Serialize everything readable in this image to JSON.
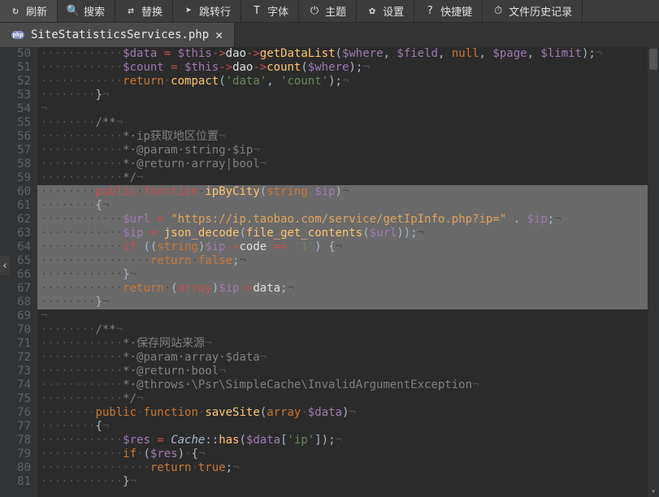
{
  "toolbar": {
    "items": [
      {
        "icon": "↻",
        "label": "刷新"
      },
      {
        "icon": "🔍",
        "label": "搜索"
      },
      {
        "icon": "⇄",
        "label": "替换"
      },
      {
        "icon": "➤",
        "label": "跳转行"
      },
      {
        "icon": "T",
        "label": "字体"
      },
      {
        "icon": "⏻",
        "label": "主题"
      },
      {
        "icon": "✿",
        "label": "设置"
      },
      {
        "icon": "?",
        "label": "快捷键"
      },
      {
        "icon": "⏱",
        "label": "文件历史记录"
      }
    ]
  },
  "tab": {
    "filename": "SiteStatisticsServices.php",
    "icon": "php"
  },
  "editor": {
    "first_line": 50,
    "selected": [
      60,
      61,
      62,
      63,
      64,
      65,
      66,
      67,
      68
    ],
    "lines": [
      [
        [
          "ws",
          "···"
        ],
        [
          "var",
          "$data"
        ],
        [
          "op",
          " "
        ],
        [
          "kw2",
          "="
        ],
        [
          "op",
          " "
        ],
        [
          "var",
          "$this"
        ],
        [
          "kw2",
          "->"
        ],
        [
          "nm",
          "dao"
        ],
        [
          "kw2",
          "->"
        ],
        [
          "fn",
          "getDataList"
        ],
        [
          "op",
          "("
        ],
        [
          "var",
          "$where"
        ],
        [
          "op",
          ", "
        ],
        [
          "var",
          "$field"
        ],
        [
          "op",
          ", "
        ],
        [
          "kw",
          "null"
        ],
        [
          "op",
          ", "
        ],
        [
          "var",
          "$page"
        ],
        [
          "op",
          ", "
        ],
        [
          "var",
          "$limit"
        ],
        [
          "op",
          ");"
        ],
        [
          "ws",
          "¬"
        ]
      ],
      [
        [
          "ws",
          "···"
        ],
        [
          "var",
          "$count"
        ],
        [
          "op",
          " "
        ],
        [
          "kw2",
          "="
        ],
        [
          "op",
          " "
        ],
        [
          "var",
          "$this"
        ],
        [
          "kw2",
          "->"
        ],
        [
          "nm",
          "dao"
        ],
        [
          "kw2",
          "->"
        ],
        [
          "fn",
          "count"
        ],
        [
          "op",
          "("
        ],
        [
          "var",
          "$where"
        ],
        [
          "op",
          ");"
        ],
        [
          "ws",
          "¬"
        ]
      ],
      [
        [
          "ws",
          "···"
        ],
        [
          "kw",
          "return"
        ],
        [
          "ws",
          "·"
        ],
        [
          "fn",
          "compact"
        ],
        [
          "op",
          "("
        ],
        [
          "str",
          "'data'"
        ],
        [
          "op",
          ", "
        ],
        [
          "str",
          "'count'"
        ],
        [
          "op",
          ");"
        ],
        [
          "ws",
          "¬"
        ]
      ],
      [
        [
          "ws",
          "··"
        ],
        [
          "op",
          "}"
        ],
        [
          "ws",
          "¬"
        ]
      ],
      [
        [
          "ws",
          "¬"
        ]
      ],
      [
        [
          "ws",
          "··"
        ],
        [
          "cmt",
          "/**"
        ],
        [
          "ws",
          "¬"
        ]
      ],
      [
        [
          "ws",
          "···"
        ],
        [
          "cmt",
          "*·ip获取地区位置"
        ],
        [
          "ws",
          "¬"
        ]
      ],
      [
        [
          "ws",
          "···"
        ],
        [
          "cmt",
          "*·@param·string·$ip"
        ],
        [
          "ws",
          "¬"
        ]
      ],
      [
        [
          "ws",
          "···"
        ],
        [
          "cmt",
          "*·@return·array|bool"
        ],
        [
          "ws",
          "¬"
        ]
      ],
      [
        [
          "ws",
          "···"
        ],
        [
          "cmt",
          "*/"
        ],
        [
          "ws",
          "¬"
        ]
      ],
      [
        [
          "ws",
          "··"
        ],
        [
          "kw2",
          "public"
        ],
        [
          "ws",
          "·"
        ],
        [
          "kw2",
          "function"
        ],
        [
          "ws",
          "·"
        ],
        [
          "fn",
          "ipByCity"
        ],
        [
          "op",
          "("
        ],
        [
          "type",
          "string"
        ],
        [
          "op",
          " "
        ],
        [
          "var",
          "$ip"
        ],
        [
          "op",
          ")"
        ],
        [
          "ws",
          "¬"
        ]
      ],
      [
        [
          "ws",
          "··"
        ],
        [
          "op",
          "{"
        ],
        [
          "ws",
          "¬"
        ]
      ],
      [
        [
          "ws",
          "···"
        ],
        [
          "var",
          "$url"
        ],
        [
          "op",
          " "
        ],
        [
          "kw2",
          "="
        ],
        [
          "op",
          " "
        ],
        [
          "str2",
          "\"https://ip.taobao.com/service/getIpInfo.php?ip=\""
        ],
        [
          "op",
          " . "
        ],
        [
          "var",
          "$ip"
        ],
        [
          "op",
          ";"
        ],
        [
          "ws",
          "¬"
        ]
      ],
      [
        [
          "ws",
          "···"
        ],
        [
          "var",
          "$ip"
        ],
        [
          "op",
          " "
        ],
        [
          "kw2",
          "="
        ],
        [
          "op",
          " "
        ],
        [
          "fn",
          "json_decode"
        ],
        [
          "op",
          "("
        ],
        [
          "fn",
          "file_get_contents"
        ],
        [
          "op",
          "("
        ],
        [
          "var",
          "$url"
        ],
        [
          "op",
          "));"
        ],
        [
          "ws",
          "¬"
        ]
      ],
      [
        [
          "ws",
          "···"
        ],
        [
          "kw2",
          "if"
        ],
        [
          "op",
          " (("
        ],
        [
          "type",
          "string"
        ],
        [
          "op",
          ")"
        ],
        [
          "var",
          "$ip"
        ],
        [
          "kw2",
          "->"
        ],
        [
          "nm",
          "code"
        ],
        [
          "op",
          " "
        ],
        [
          "kw2",
          "=="
        ],
        [
          "op",
          " "
        ],
        [
          "str",
          "'1'"
        ],
        [
          "op",
          ") {"
        ],
        [
          "ws",
          "¬"
        ]
      ],
      [
        [
          "ws",
          "····"
        ],
        [
          "kw",
          "return"
        ],
        [
          "ws",
          "·"
        ],
        [
          "kw",
          "false"
        ],
        [
          "op",
          ";"
        ],
        [
          "ws",
          "¬"
        ]
      ],
      [
        [
          "ws",
          "···"
        ],
        [
          "op",
          "}"
        ],
        [
          "ws",
          "¬"
        ]
      ],
      [
        [
          "ws",
          "···"
        ],
        [
          "kw",
          "return"
        ],
        [
          "ws",
          "·"
        ],
        [
          "op",
          "("
        ],
        [
          "kw2",
          "array"
        ],
        [
          "op",
          ")"
        ],
        [
          "var",
          "$ip"
        ],
        [
          "kw2",
          "->"
        ],
        [
          "nm",
          "data"
        ],
        [
          "op",
          ";"
        ],
        [
          "ws",
          "¬"
        ]
      ],
      [
        [
          "ws",
          "··"
        ],
        [
          "op",
          "}"
        ],
        [
          "ws",
          "¬"
        ]
      ],
      [
        [
          "ws",
          "¬"
        ]
      ],
      [
        [
          "ws",
          "··"
        ],
        [
          "cmt",
          "/**"
        ],
        [
          "ws",
          "¬"
        ]
      ],
      [
        [
          "ws",
          "···"
        ],
        [
          "cmt",
          "*·保存网站来源"
        ],
        [
          "ws",
          "¬"
        ]
      ],
      [
        [
          "ws",
          "···"
        ],
        [
          "cmt",
          "*·@param·array·$data"
        ],
        [
          "ws",
          "¬"
        ]
      ],
      [
        [
          "ws",
          "···"
        ],
        [
          "cmt",
          "*·@return·bool"
        ],
        [
          "ws",
          "¬"
        ]
      ],
      [
        [
          "ws",
          "···"
        ],
        [
          "cmt",
          "*·@throws·\\Psr\\SimpleCache\\InvalidArgumentException"
        ],
        [
          "ws",
          "¬"
        ]
      ],
      [
        [
          "ws",
          "···"
        ],
        [
          "cmt",
          "*/"
        ],
        [
          "ws",
          "¬"
        ]
      ],
      [
        [
          "ws",
          "··"
        ],
        [
          "kw",
          "public"
        ],
        [
          "ws",
          "·"
        ],
        [
          "kw",
          "function"
        ],
        [
          "ws",
          "·"
        ],
        [
          "fn",
          "saveSite"
        ],
        [
          "op",
          "("
        ],
        [
          "type",
          "array"
        ],
        [
          "ws",
          "·"
        ],
        [
          "var",
          "$data"
        ],
        [
          "op",
          ")"
        ],
        [
          "ws",
          "¬"
        ]
      ],
      [
        [
          "ws",
          "··"
        ],
        [
          "op",
          "{"
        ],
        [
          "ws",
          "¬"
        ]
      ],
      [
        [
          "ws",
          "···"
        ],
        [
          "var",
          "$res"
        ],
        [
          "op",
          " "
        ],
        [
          "kw2",
          "="
        ],
        [
          "op",
          " "
        ],
        [
          "cls",
          "Cache"
        ],
        [
          "op",
          "::"
        ],
        [
          "fn",
          "has"
        ],
        [
          "op",
          "("
        ],
        [
          "var",
          "$data"
        ],
        [
          "op",
          "["
        ],
        [
          "str",
          "'ip'"
        ],
        [
          "op",
          "]);"
        ],
        [
          "ws",
          "¬"
        ]
      ],
      [
        [
          "ws",
          "···"
        ],
        [
          "kw",
          "if"
        ],
        [
          "ws",
          "·"
        ],
        [
          "op",
          "("
        ],
        [
          "var",
          "$res"
        ],
        [
          "op",
          ")"
        ],
        [
          "ws",
          "·"
        ],
        [
          "op",
          "{"
        ],
        [
          "ws",
          "¬"
        ]
      ],
      [
        [
          "ws",
          "····"
        ],
        [
          "kw",
          "return"
        ],
        [
          "ws",
          "·"
        ],
        [
          "kw",
          "true"
        ],
        [
          "op",
          ";"
        ],
        [
          "ws",
          "¬"
        ]
      ],
      [
        [
          "ws",
          "···"
        ],
        [
          "op",
          "}"
        ],
        [
          "ws",
          "¬"
        ]
      ]
    ]
  }
}
